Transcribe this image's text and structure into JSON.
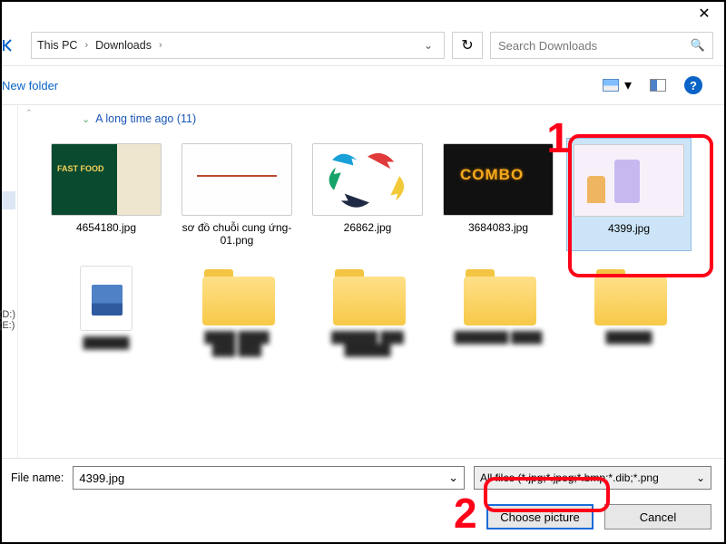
{
  "window": {
    "close_glyph": "✕"
  },
  "breadcrumb": {
    "segments": [
      "This PC",
      "Downloads"
    ],
    "sep_glyph": "›",
    "dropdown_glyph": "⌄",
    "refresh_glyph": "↻"
  },
  "search": {
    "placeholder": "Search Downloads",
    "icon_glyph": "🔍"
  },
  "toolbar": {
    "new_folder_label": "New folder",
    "view_dropdown_glyph": "▾",
    "help_glyph": "?"
  },
  "sidebar": {
    "drives": [
      "(D:)",
      "(E:)"
    ]
  },
  "group": {
    "chevron_glyph": "⌄",
    "label": "A long time ago (11)"
  },
  "files": [
    {
      "name": "4654180.jpg"
    },
    {
      "name": "sơ đồ chuỗi cung ứng-01.png"
    },
    {
      "name": "26862.jpg"
    },
    {
      "name": "3684083.jpg"
    },
    {
      "name": "4399.jpg",
      "selected": true
    }
  ],
  "footer": {
    "filename_label": "File name:",
    "filename_value": "4399.jpg",
    "filter_label": "All files (*.jpg;*.jpeg;*.bmp;*.dib;*.png",
    "dropdown_glyph": "⌄",
    "choose_label": "Choose picture",
    "cancel_label": "Cancel"
  },
  "annotations": {
    "one": "1",
    "two": "2"
  }
}
